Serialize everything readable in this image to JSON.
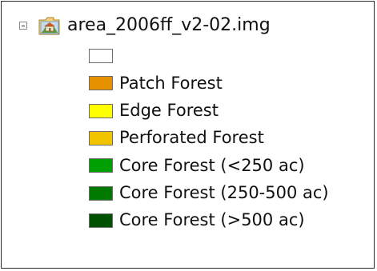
{
  "layer": {
    "name": "area_2006ff_v2-02.img",
    "icon": "raster-layer-icon",
    "expander_icon": "collapse-minus-icon"
  },
  "legend": {
    "items": [
      {
        "label": "",
        "color": "#ffffff"
      },
      {
        "label": "Patch Forest",
        "color": "#e69100"
      },
      {
        "label": "Edge Forest",
        "color": "#ffff00"
      },
      {
        "label": "Perforated Forest",
        "color": "#f2c400"
      },
      {
        "label": "Core Forest (<250 ac)",
        "color": "#00a000"
      },
      {
        "label": "Core Forest (250-500 ac)",
        "color": "#007a00"
      },
      {
        "label": "Core Forest (>500 ac)",
        "color": "#005200"
      }
    ]
  }
}
